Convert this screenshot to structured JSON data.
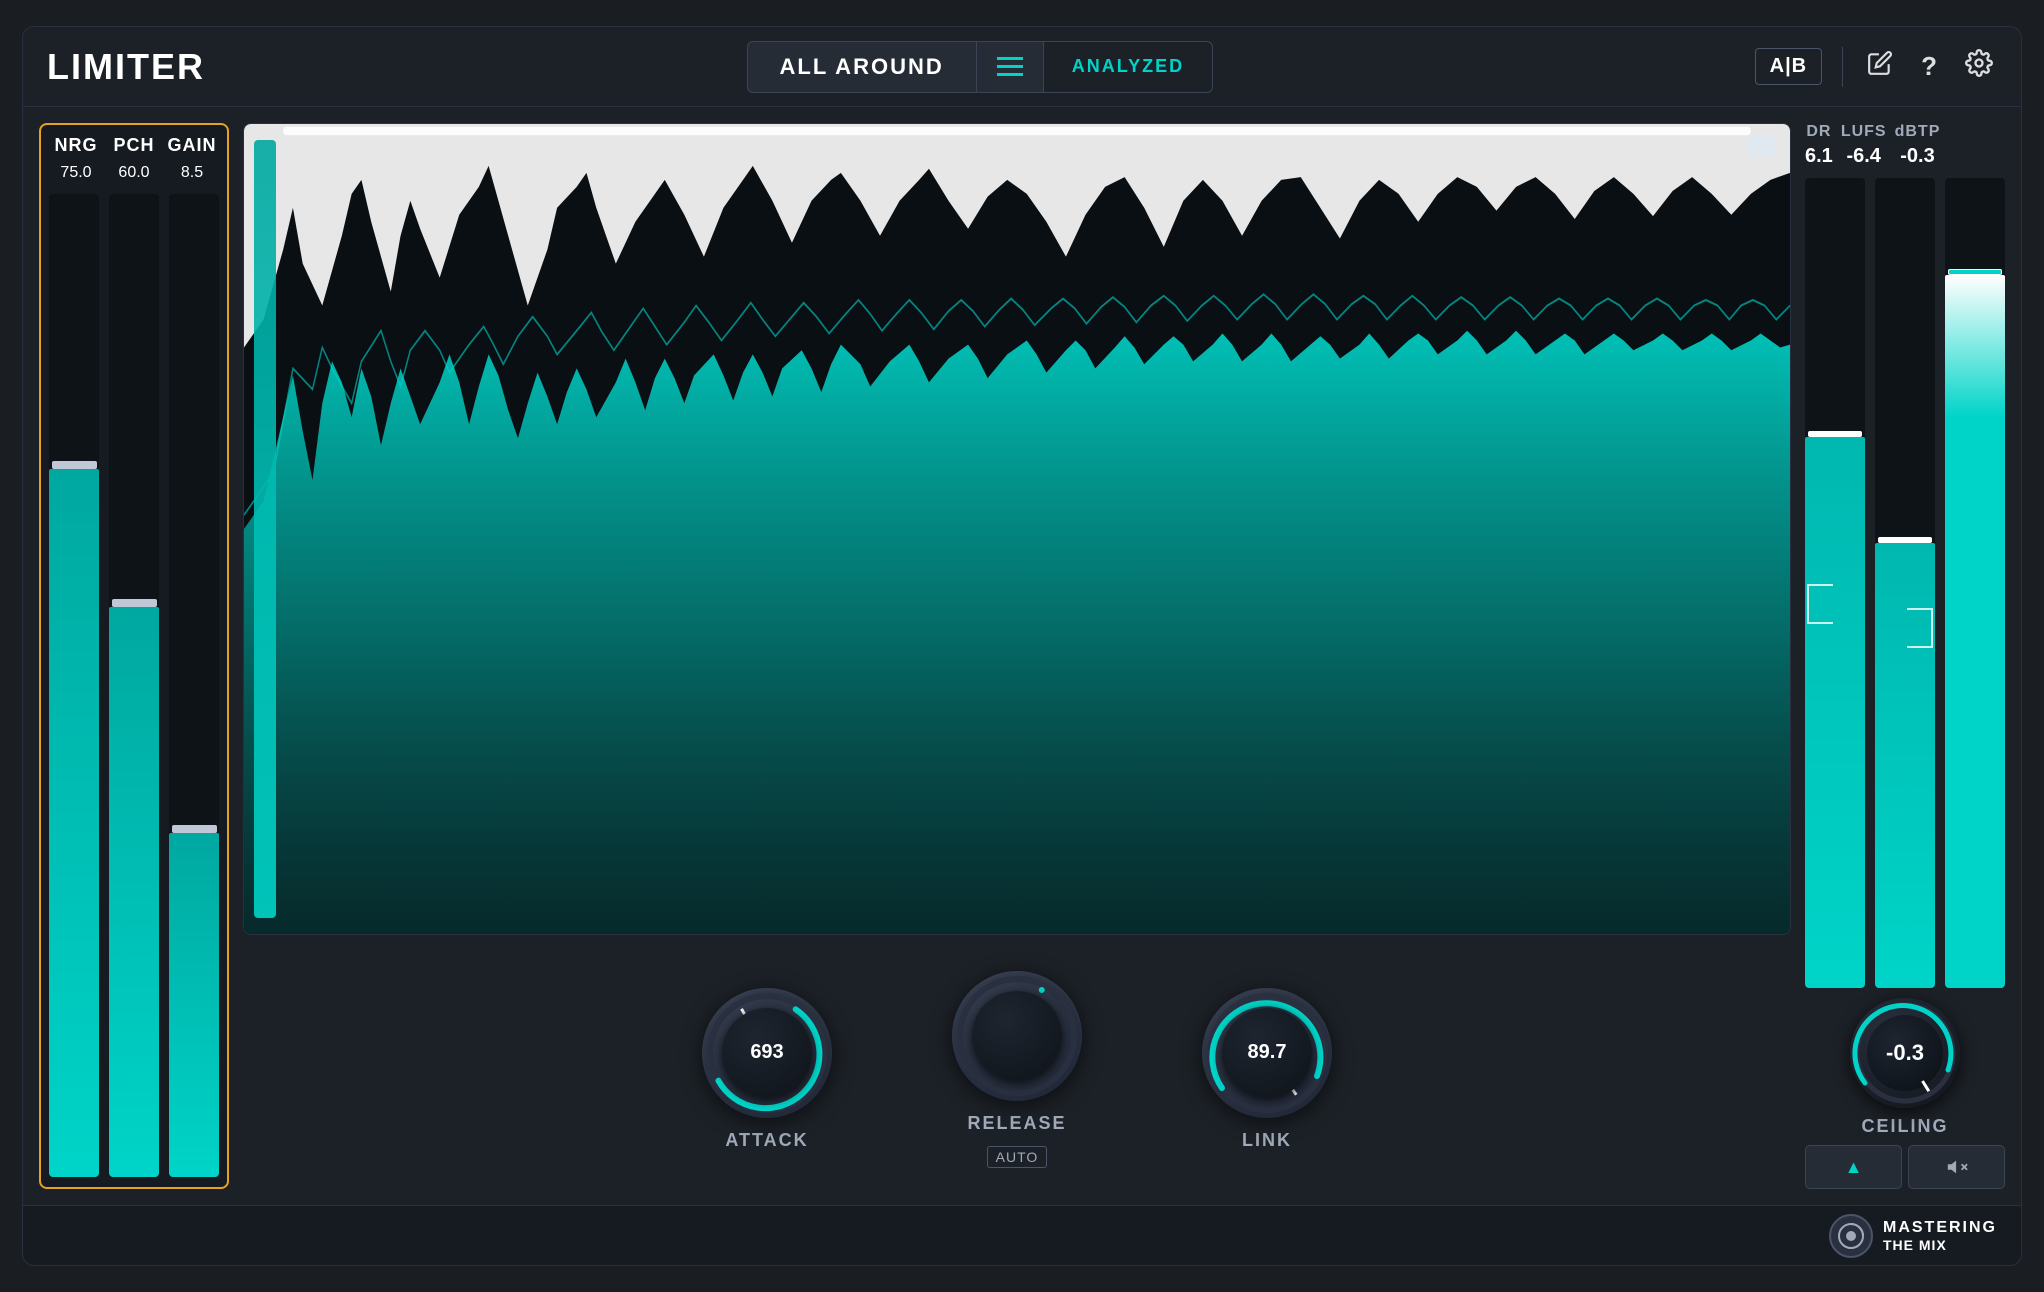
{
  "app": {
    "title": "LIMITER",
    "preset_name": "ALL AROUND",
    "analyzed_label": "ANALYZED",
    "ab_label": "A|B"
  },
  "header": {
    "icon_pencil": "✏",
    "icon_question": "?",
    "icon_gear": "⚙"
  },
  "left_panel": {
    "labels": [
      "NRG",
      "PCH",
      "GAIN"
    ],
    "values": [
      "75.0",
      "60.0",
      "8.5"
    ],
    "nrg_fill_pct": 72,
    "pch_fill_pct": 58,
    "gain_fill_pct": 35,
    "nrg_thumb_pct": 28,
    "pch_thumb_pct": 40,
    "gain_thumb_pct": 65
  },
  "controls": {
    "attack_value": "693",
    "attack_label": "ATTACK",
    "release_label": "RELEASE",
    "release_sub": "AUTO",
    "link_value": "89.7",
    "link_label": "LINK"
  },
  "right_panel": {
    "dr_label": "DR",
    "lufs_label": "LUFS",
    "dbtp_label": "dBTP",
    "dr_value": "6.1",
    "lufs_value": "-6.4",
    "dbtp_value": "-0.3",
    "meter1_fill_pct": 68,
    "meter2_fill_pct": 55,
    "meter3_fill_pct": 82,
    "ceiling_value": "-0.3",
    "ceiling_label": "CEILING",
    "btn_triangle": "▲",
    "btn_mute": "🔇"
  },
  "brand": {
    "mastering": "MASTERING",
    "the_mix": "THE MIX"
  }
}
